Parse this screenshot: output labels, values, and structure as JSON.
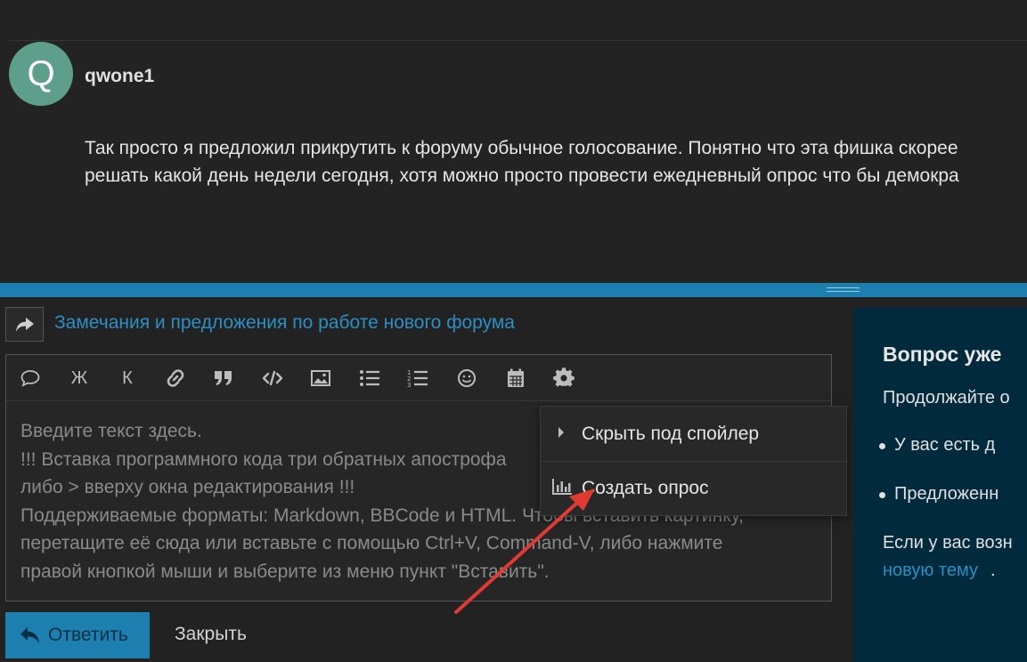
{
  "post": {
    "avatar_letter": "Q",
    "username": "qwone1",
    "body_line1": "Так просто я предложил прикрутить к форуму обычное голосование. Понятно что эта фишка скорее",
    "body_line2": "решать какой день недели сегодня, хотя можно просто провести ежедневный опрос что бы демокра"
  },
  "reply": {
    "thread_title": "Замечания и предложения по работе нового форума"
  },
  "toolbar": {
    "buttons": [
      {
        "name": "quote-button",
        "icon": "speech-bubble-icon",
        "glyph": ""
      },
      {
        "name": "bold-button",
        "icon": "bold-icon",
        "glyph": "Ж"
      },
      {
        "name": "italic-button",
        "icon": "italic-icon",
        "glyph": "К"
      },
      {
        "name": "link-button",
        "icon": "link-icon",
        "glyph": ""
      },
      {
        "name": "blockquote-button",
        "icon": "quote-icon",
        "glyph": ""
      },
      {
        "name": "code-button",
        "icon": "code-icon",
        "glyph": ""
      },
      {
        "name": "image-button",
        "icon": "image-icon",
        "glyph": ""
      },
      {
        "name": "bullet-list-button",
        "icon": "bullet-list-icon",
        "glyph": ""
      },
      {
        "name": "numbered-list-button",
        "icon": "numbered-list-icon",
        "glyph": ""
      },
      {
        "name": "emoji-button",
        "icon": "smile-icon",
        "glyph": ""
      },
      {
        "name": "calendar-button",
        "icon": "calendar-icon",
        "glyph": ""
      },
      {
        "name": "settings-button",
        "icon": "gear-icon",
        "glyph": ""
      }
    ]
  },
  "editor": {
    "placeholder_lines": [
      "Введите текст здесь.",
      "!!! Вставка программного кода три обратных апострофа",
      "либо  > вверху окна редактирования !!!",
      "Поддерживаемые форматы: Markdown, BBCode и HTML. Чтобы вставить картинку,",
      "перетащите её сюда или вставьте с помощью Ctrl+V, Command-V, либо нажмите",
      "правой кнопкой мыши и выберите из меню пункт \"Вставить\"."
    ]
  },
  "dropdown": {
    "spoiler_label": "Скрыть под спойлер",
    "poll_label": "Создать опрос"
  },
  "actions": {
    "reply_label": "Ответить",
    "close_label": "Закрыть"
  },
  "side": {
    "title": "Вопрос уже",
    "intro": "Продолжайте о",
    "bullet1": "У вас есть д",
    "bullet2": "Предложенн",
    "note": "Если у вас возн",
    "link": "новую тему",
    "link_suffix": "."
  },
  "colors": {
    "accent": "#1c7fb0",
    "link": "#2b8fc5",
    "annotation_arrow": "#e03a33",
    "side_panel": "#012a3c"
  }
}
